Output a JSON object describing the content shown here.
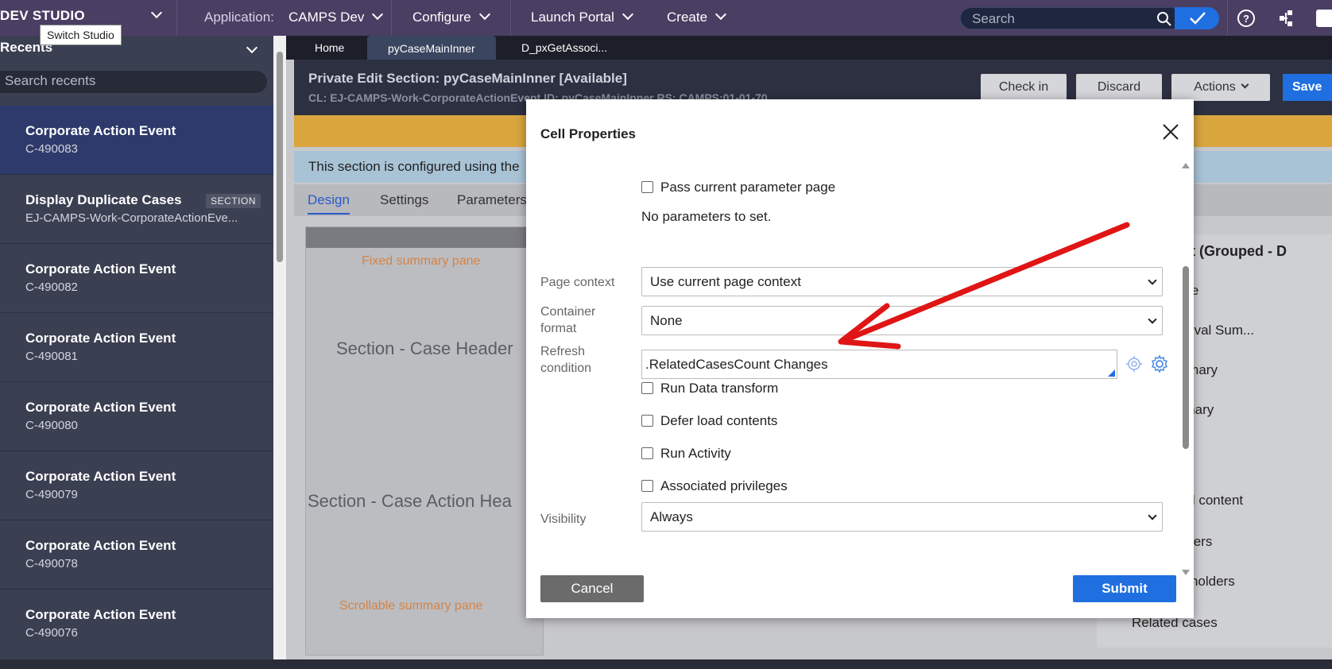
{
  "topbar": {
    "brand": "DEV STUDIO",
    "tooltip": "Switch Studio",
    "application_label": "Application:",
    "application_value": "CAMPS Dev",
    "menu_configure": "Configure",
    "menu_launch_portal": "Launch Portal",
    "menu_create": "Create",
    "search_placeholder": "Search"
  },
  "left": {
    "header": "Recents",
    "search_placeholder": "Search recents",
    "items": [
      {
        "title": "Corporate Action Event",
        "sub": "C-490083",
        "badge": ""
      },
      {
        "title": "Display Duplicate Cases",
        "sub": "EJ-CAMPS-Work-CorporateActionEve...",
        "badge": "SECTION"
      },
      {
        "title": "Corporate Action Event",
        "sub": "C-490082",
        "badge": ""
      },
      {
        "title": "Corporate Action Event",
        "sub": "C-490081",
        "badge": ""
      },
      {
        "title": "Corporate Action Event",
        "sub": "C-490080",
        "badge": ""
      },
      {
        "title": "Corporate Action Event",
        "sub": "C-490079",
        "badge": ""
      },
      {
        "title": "Corporate Action Event",
        "sub": "C-490078",
        "badge": ""
      },
      {
        "title": "Corporate Action Event",
        "sub": "C-490076",
        "badge": ""
      }
    ]
  },
  "tabs": [
    "Home",
    "pyCaseMainInner",
    "D_pxGetAssoci..."
  ],
  "doc": {
    "title": "Private Edit  Section: pyCaseMainInner [Available]",
    "sub": "CL:  EJ-CAMPS-Work-CorporateActionEvent   ID:  pyCaseMainInner   RS:  CAMPS:01-01-70",
    "btn_checkin": "Check in",
    "btn_discard": "Discard",
    "btn_actions": "Actions",
    "btn_save": "Save",
    "info": "This section is configured using the"
  },
  "subtabs": [
    "Design",
    "Settings",
    "Parameters"
  ],
  "canvas": {
    "fixed_pane": "Fixed summary pane",
    "case_header": "Section - Case Header",
    "case_action": "Section - Case Action Hea",
    "scroll_pane": "Scrollable summary pane"
  },
  "right": {
    "title": "ntent (Grouped - D",
    "items": [
      "age",
      "proval Sum...",
      "mmary",
      "nmary",
      "ted content",
      "owers",
      "keholders",
      "Related cases"
    ]
  },
  "dialog": {
    "title": "Cell Properties",
    "pass_param": "Pass current parameter page",
    "no_params": "No parameters to set.",
    "page_context_label": "Page context",
    "page_context_value": "Use current page context",
    "container_format_label": "Container format",
    "container_format_value": "None",
    "refresh_label": "Refresh condition",
    "refresh_value": ".RelatedCasesCount Changes",
    "run_dt": "Run Data transform",
    "defer": "Defer load contents",
    "run_activity": "Run Activity",
    "assoc_priv": "Associated privileges",
    "visibility_label": "Visibility",
    "visibility_value": "Always",
    "cancel": "Cancel",
    "submit": "Submit"
  },
  "colors": {
    "topbar": "#4b3e63",
    "accent": "#1f6fe0",
    "arrow": "#e01515"
  }
}
